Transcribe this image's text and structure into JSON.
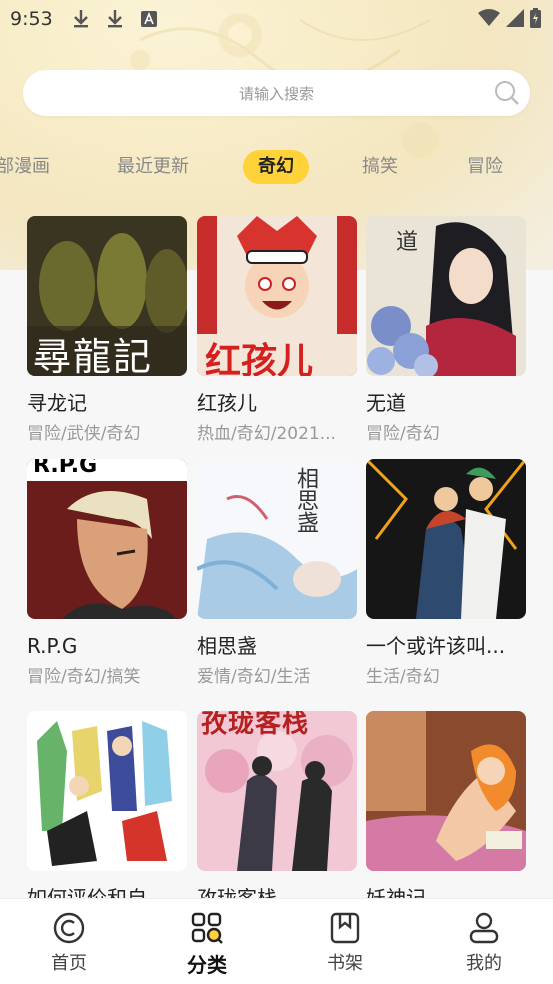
{
  "status_bar": {
    "time": "9:53",
    "icons": [
      "download-icon",
      "download-icon",
      "font-icon",
      "wifi-icon",
      "signal-icon",
      "battery-icon"
    ]
  },
  "search": {
    "placeholder": "请输入搜索"
  },
  "tabs": [
    {
      "label": "部漫画",
      "active": false
    },
    {
      "label": "最近更新",
      "active": false
    },
    {
      "label": "奇幻",
      "active": true
    },
    {
      "label": "搞笑",
      "active": false
    },
    {
      "label": "冒险",
      "active": false
    }
  ],
  "comics": [
    {
      "title": "寻龙记",
      "tags": "冒险/武侠/奇幻",
      "cover_text": "尋龍記"
    },
    {
      "title": "红孩儿",
      "tags": "热血/奇幻/2021...",
      "cover_text": "红孩儿"
    },
    {
      "title": "无道",
      "tags": "冒险/奇幻",
      "cover_text": "道"
    },
    {
      "title": "R.P.G",
      "tags": "冒险/奇幻/搞笑",
      "cover_text": "R.P.G"
    },
    {
      "title": "相思盏",
      "tags": "爱情/奇幻/生活",
      "cover_text": "相思盏"
    },
    {
      "title": "一个或许该叫...",
      "tags": "生活/奇幻",
      "cover_text": ""
    },
    {
      "title": "如何评价和自...",
      "tags": "",
      "cover_text": ""
    },
    {
      "title": "孜珑客栈",
      "tags": "",
      "cover_text": "孜珑客栈"
    },
    {
      "title": "妖神记",
      "tags": "",
      "cover_text": ""
    }
  ],
  "bottom_nav": [
    {
      "label": "首页",
      "icon": "home-icon",
      "active": false
    },
    {
      "label": "分类",
      "icon": "category-icon",
      "active": true
    },
    {
      "label": "书架",
      "icon": "bookshelf-icon",
      "active": false
    },
    {
      "label": "我的",
      "icon": "profile-icon",
      "active": false
    }
  ],
  "colors": {
    "accent": "#ffd23a",
    "background": "#f7f7f7",
    "text_primary": "#222222",
    "text_secondary": "#999999"
  }
}
